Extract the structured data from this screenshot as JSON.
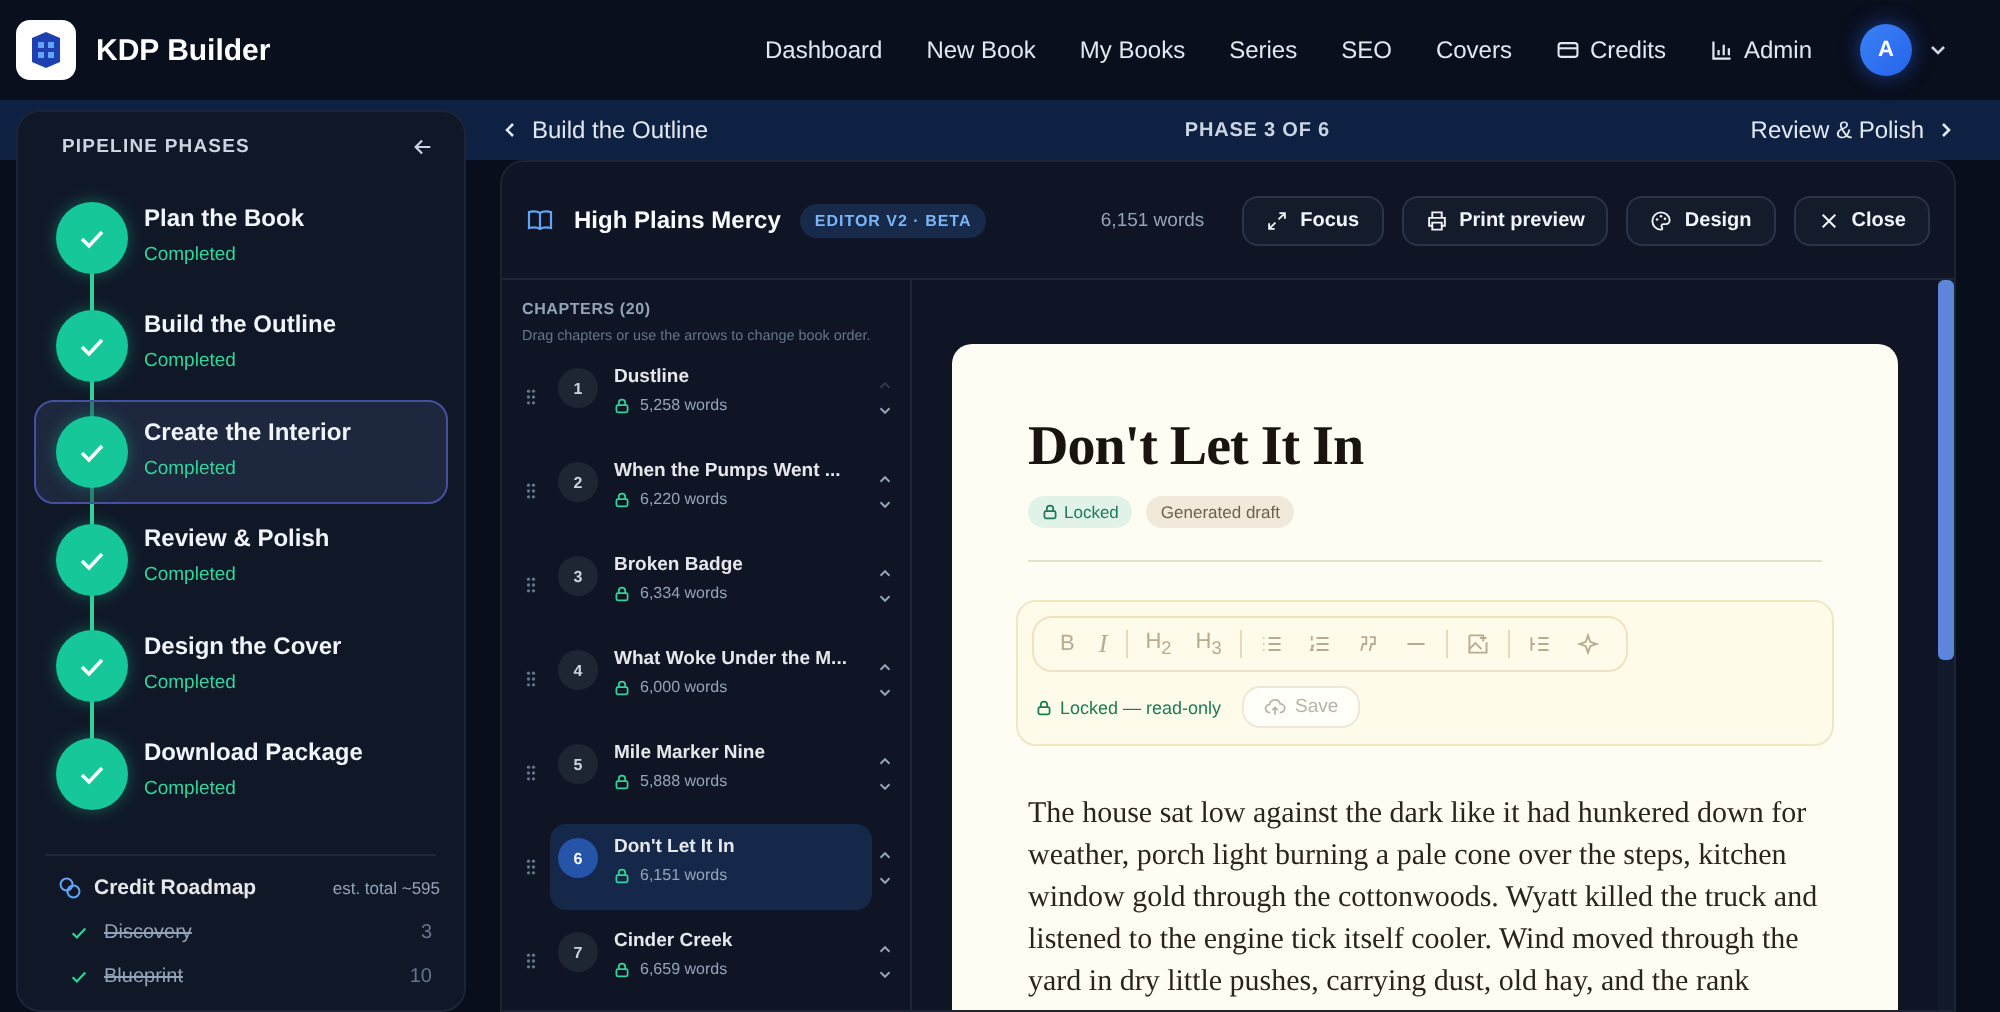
{
  "app": {
    "name": "KDP Builder"
  },
  "nav": [
    {
      "label": "Dashboard"
    },
    {
      "label": "New Book"
    },
    {
      "label": "My Books"
    },
    {
      "label": "Series"
    },
    {
      "label": "SEO"
    },
    {
      "label": "Covers"
    },
    {
      "label": "Credits"
    },
    {
      "label": "Admin"
    }
  ],
  "user": {
    "initial": "A"
  },
  "phase_bar": {
    "prev": "Build the Outline",
    "current": "PHASE 3 OF 6",
    "next": "Review & Polish"
  },
  "sidebar": {
    "title": "PIPELINE PHASES",
    "phases": [
      {
        "name": "Plan the Book",
        "status": "Completed",
        "completed": true,
        "selected": false
      },
      {
        "name": "Build the Outline",
        "status": "Completed",
        "completed": true,
        "selected": false
      },
      {
        "name": "Create the Interior",
        "status": "Completed",
        "completed": true,
        "selected": true
      },
      {
        "name": "Review & Polish",
        "status": "Completed",
        "completed": true,
        "selected": false
      },
      {
        "name": "Design the Cover",
        "status": "Completed",
        "completed": true,
        "selected": false
      },
      {
        "name": "Download Package",
        "status": "Completed",
        "completed": true,
        "selected": false
      }
    ],
    "credit_roadmap": {
      "title": "Credit Roadmap",
      "estimate": "est. total ~595",
      "items": [
        {
          "name": "Discovery",
          "cost": "3",
          "done": true
        },
        {
          "name": "Blueprint",
          "cost": "10",
          "done": true
        }
      ]
    }
  },
  "editor": {
    "book_title": "High Plains Mercy",
    "badge": "EDITOR V2 · BETA",
    "word_count": "6,151 words",
    "actions": [
      {
        "label": "Focus"
      },
      {
        "label": "Print preview"
      },
      {
        "label": "Design"
      },
      {
        "label": "Close"
      }
    ],
    "chapters": {
      "title": "CHAPTERS (20)",
      "hint": "Drag chapters or use the arrows to change book order.",
      "items": [
        {
          "number": "1",
          "title": "Dustline",
          "words": "5,258 words",
          "locked": true,
          "selected": false,
          "can_move_up": false
        },
        {
          "number": "2",
          "title": "When the Pumps Went ...",
          "words": "6,220 words",
          "locked": true,
          "selected": false,
          "can_move_up": true
        },
        {
          "number": "3",
          "title": "Broken Badge",
          "words": "6,334 words",
          "locked": true,
          "selected": false,
          "can_move_up": true
        },
        {
          "number": "4",
          "title": "What Woke Under the M...",
          "words": "6,000 words",
          "locked": true,
          "selected": false,
          "can_move_up": true
        },
        {
          "number": "5",
          "title": "Mile Marker Nine",
          "words": "5,888 words",
          "locked": true,
          "selected": false,
          "can_move_up": true
        },
        {
          "number": "6",
          "title": "Don't Let It In",
          "words": "6,151 words",
          "locked": true,
          "selected": true,
          "can_move_up": true
        },
        {
          "number": "7",
          "title": "Cinder Creek",
          "words": "6,659 words",
          "locked": true,
          "selected": false,
          "can_move_up": true
        }
      ]
    },
    "document": {
      "title": "Don't Let It In",
      "tags": [
        {
          "label": "Locked",
          "kind": "locked"
        },
        {
          "label": "Generated draft",
          "kind": "draft"
        }
      ],
      "toolbar": [
        {
          "kind": "text",
          "label": "B"
        },
        {
          "kind": "text",
          "label": "I"
        },
        {
          "kind": "divider"
        },
        {
          "kind": "text",
          "label": "H$_{2}$"
        },
        {
          "kind": "text",
          "label": "H$_{3}$"
        },
        {
          "kind": "divider"
        },
        {
          "kind": "icon"
        },
        {
          "kind": "icon"
        },
        {
          "kind": "icon"
        },
        {
          "kind": "icon"
        },
        {
          "kind": "divider"
        },
        {
          "kind": "icon"
        },
        {
          "kind": "divider"
        },
        {
          "kind": "icon"
        },
        {
          "kind": "icon"
        }
      ],
      "lock_status": "Locked — read-only",
      "save": {
        "label": "Save",
        "disabled": true
      },
      "body": "The house sat low against the dark like it had hunkered down for weather, porch light burning a pale cone over the steps, kitchen window gold through the cottonwoods. Wyatt killed the truck and listened to the engine tick itself cooler. Wind moved through the yard in dry little pushes, carrying dust, old hay, and the rank"
    }
  }
}
